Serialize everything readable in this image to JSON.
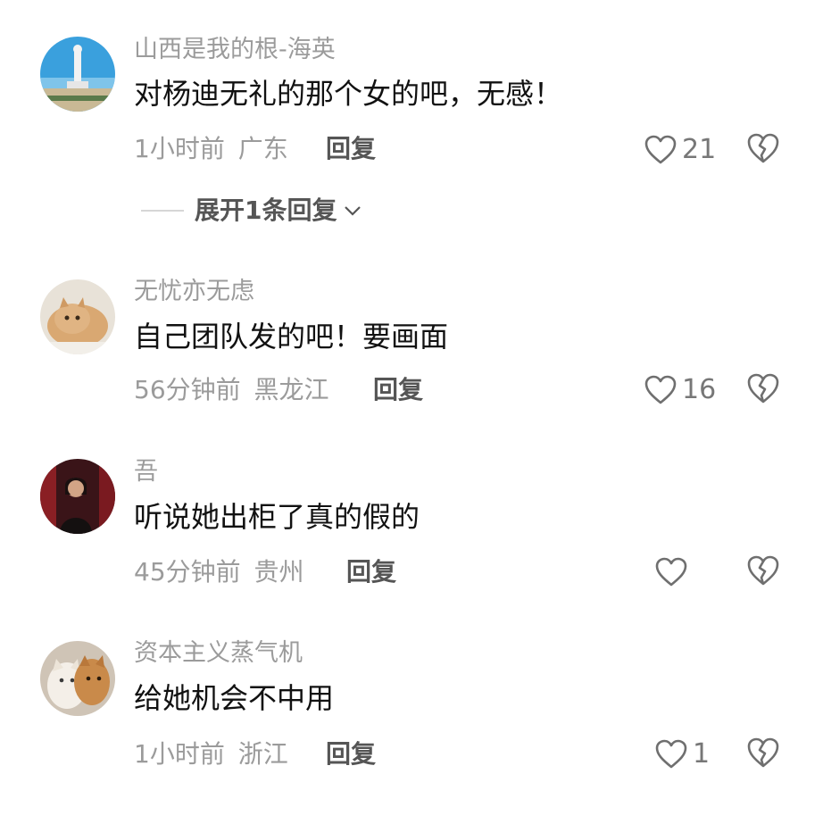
{
  "comments": [
    {
      "username": "山西是我的根-海英",
      "content": "对杨迪无礼的那个女的吧，无感！",
      "time": "1小时前",
      "location": "广东",
      "reply_label": "回复",
      "likes": "21",
      "expand_label": "展开1条回复",
      "avatar_icon": "statue-landscape-avatar"
    },
    {
      "username": "无忧亦无虑",
      "content": "自己团队发的吧！要画面",
      "time": "56分钟前",
      "location": "黑龙江",
      "reply_label": "回复",
      "likes": "16",
      "avatar_icon": "cat-avatar"
    },
    {
      "username": "吾",
      "content": "听说她出柜了真的假的",
      "time": "45分钟前",
      "location": "贵州",
      "reply_label": "回复",
      "likes": "",
      "avatar_icon": "woman-photo-avatar"
    },
    {
      "username": "资本主义蒸气机",
      "content": "给她机会不中用",
      "time": "1小时前",
      "location": "浙江",
      "reply_label": "回复",
      "likes": "1",
      "avatar_icon": "kittens-avatar"
    }
  ],
  "colors": {
    "meta_text": "#9b9b9b",
    "content_text": "#111111",
    "icon_stroke": "#6f6f6f"
  }
}
